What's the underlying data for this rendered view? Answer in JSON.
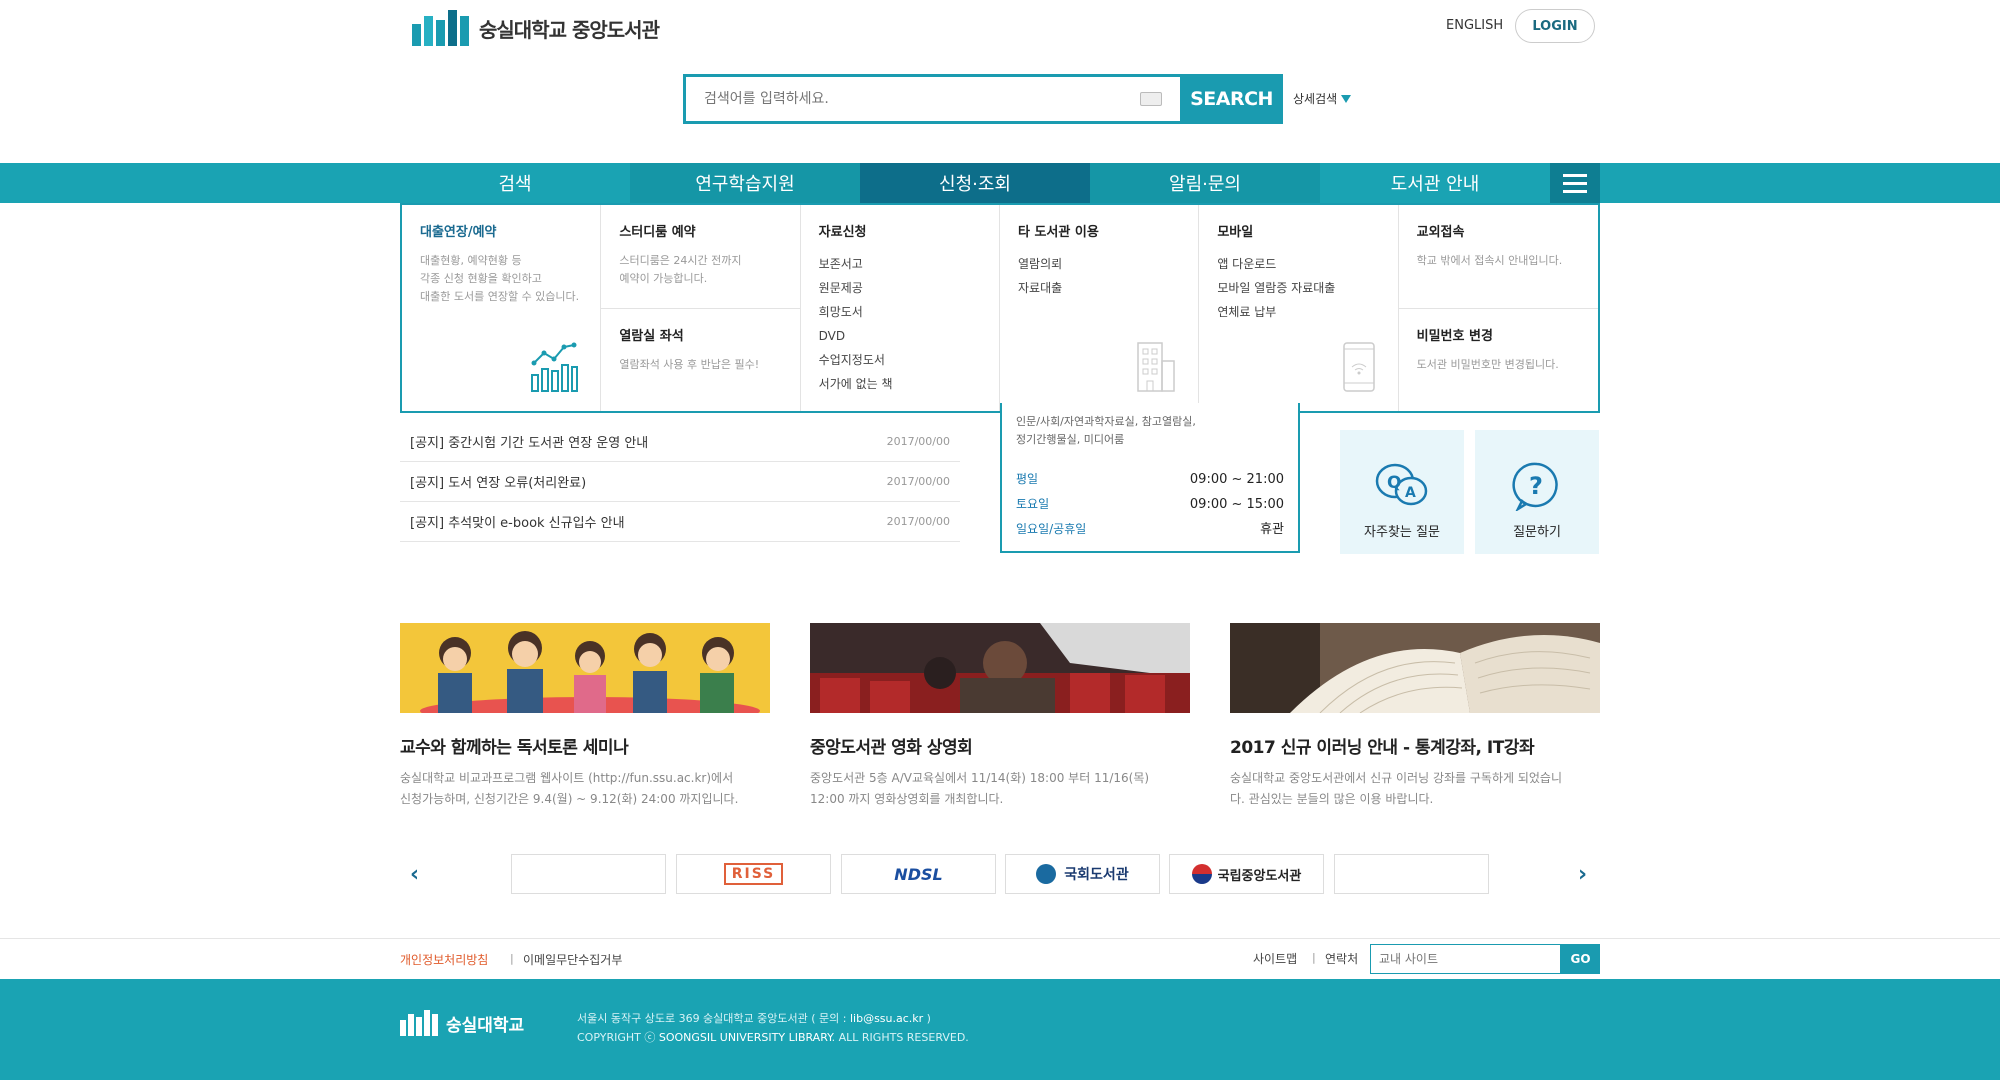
{
  "header": {
    "logo_text": "숭실대학교 중앙도서관",
    "english": "ENGLISH",
    "login": "LOGIN"
  },
  "search": {
    "placeholder": "검색어를 입력하세요.",
    "button": "SEARCH",
    "advanced": "상세검색"
  },
  "nav": {
    "items": [
      "검색",
      "연구학습지원",
      "신청·조회",
      "알림·문의",
      "도서관 안내"
    ],
    "active_index": 2
  },
  "mega_menu": {
    "col1": {
      "title": "대출연장/예약",
      "desc": [
        "대출현황, 예약현황 등",
        "각종 신청 현황을 확인하고",
        "대출한 도서를 연장할 수 있습니다."
      ]
    },
    "col2a": {
      "title": "스터디룸 예약",
      "desc": [
        "스터디룸은 24시간 전까지",
        "예약이 가능합니다."
      ]
    },
    "col2b": {
      "title": "열람실 좌석",
      "desc": [
        "열람좌석 사용 후 반납은 필수!"
      ]
    },
    "col3": {
      "title": "자료신청",
      "items": [
        "보존서고",
        "원문제공",
        "희망도서",
        "DVD",
        "수업지정도서",
        "서가에 없는 책"
      ]
    },
    "col4": {
      "title": "타 도서관 이용",
      "items": [
        "열람의뢰",
        "자료대출"
      ]
    },
    "col5": {
      "title": "모바일",
      "items": [
        "앱 다운로드",
        "모바일 열람증 자료대출",
        "연체료 납부"
      ]
    },
    "col6a": {
      "title": "교외접속",
      "desc": [
        "학교 밖에서 접속시 안내입니다."
      ]
    },
    "col6b": {
      "title": "비밀번호 변경",
      "desc": [
        "도서관 비밀번호만 변경됩니다."
      ]
    }
  },
  "notices": [
    {
      "title": "[공지] 중간시험 기간 도서관 연장 운영 안내",
      "date": "2017/00/00"
    },
    {
      "title": "[공지] 도서 연장 오류(처리완료)",
      "date": "2017/00/00"
    },
    {
      "title": "[공지] 추석맞이 e-book 신규입수 안내",
      "date": "2017/00/00"
    }
  ],
  "hours": {
    "place": [
      "인문/사회/자연과학자료실, 참고열람실,",
      "정기간행물실, 미디어룸"
    ],
    "rows": [
      {
        "day": "평일",
        "time": "09:00 ~ 21:00"
      },
      {
        "day": "토요일",
        "time": "09:00 ~ 15:00"
      },
      {
        "day": "일요일/공휴일",
        "time": "휴관"
      }
    ]
  },
  "quick": {
    "faq": "자주찾는 질문",
    "ask": "질문하기"
  },
  "banners": [
    {
      "title": "교수와 함께하는 독서토론 세미나",
      "desc": [
        "숭실대학교 비교과프로그램 웹사이트 (http://fun.ssu.ac.kr)에서",
        "신청가능하며, 신청기간은 9.4(월) ~ 9.12(화) 24:00 까지입니다."
      ]
    },
    {
      "title": "중앙도서관 영화 상영회",
      "desc": [
        "중앙도서관 5층 A/V교육실에서 11/14(화) 18:00 부터 11/16(목)",
        "12:00 까지 영화상영회를 개최합니다."
      ]
    },
    {
      "title": "2017 신규 이러닝 안내 - 통계강좌, IT강좌",
      "desc": [
        "숭실대학교 중앙도서관에서 신규 이러닝 강좌를 구독하게 되었습니",
        "다. 관심있는 분들의 많은 이용 바랍니다."
      ]
    }
  ],
  "partners": [
    "",
    "RISS",
    "NDSL",
    "국회도서관",
    "국립중앙도서관",
    ""
  ],
  "footer_links": {
    "privacy": "개인정보처리방침",
    "email_refuse": "이메일무단수집거부",
    "sitemap": "사이트맵",
    "contact": "연락처",
    "site_placeholder": "교내 사이트",
    "go": "GO"
  },
  "footer": {
    "logo_text": "숭실대학교",
    "address": "서울시 동작구 상도로 369  숭실대학교 중앙도서관 ( 문의 : ",
    "email": "lib@ssu.ac.kr",
    "address_end": " )",
    "copyright_pre": "COPYRIGHT  ⓒ  ",
    "copyright_name": "SOONGSIL UNIVERSITY LIBRARY",
    "copyright_post": ". ALL RIGHTS RESERVED."
  },
  "colors": {
    "primary": "#1aa3b3",
    "dark": "#0d6e8a",
    "privacy": "#e05a2a"
  }
}
